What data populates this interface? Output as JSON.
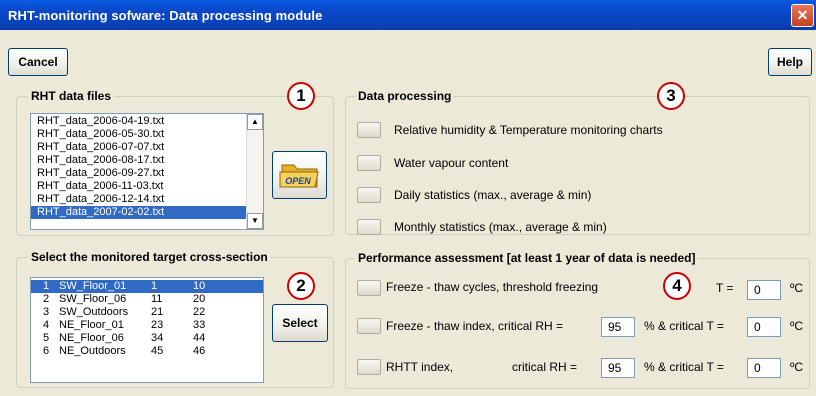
{
  "window": {
    "title": "RHT-monitoring sofware:  Data processing module",
    "close_glyph": "✕"
  },
  "toolbar": {
    "cancel_label": "Cancel",
    "help_label": "Help"
  },
  "files_group": {
    "title": "RHT data files",
    "badge": "1",
    "files": [
      "RHT_data_2006-04-19.txt",
      "RHT_data_2006-05-30.txt",
      "RHT_data_2006-07-07.txt",
      "RHT_data_2006-08-17.txt",
      "RHT_data_2006-09-27.txt",
      "RHT_data_2006-11-03.txt",
      "RHT_data_2006-12-14.txt",
      "RHT_data_2007-02-02.txt"
    ],
    "selected_index": 7,
    "open_label": "OPEN"
  },
  "target_group": {
    "title": "Select the monitored target cross-section",
    "badge": "2",
    "rows": [
      {
        "n": "1",
        "name": "SW_Floor_01",
        "a": "1",
        "b": "10"
      },
      {
        "n": "2",
        "name": "SW_Floor_06",
        "a": "11",
        "b": "20"
      },
      {
        "n": "3",
        "name": "SW_Outdoors",
        "a": "21",
        "b": "22"
      },
      {
        "n": "4",
        "name": "NE_Floor_01",
        "a": "23",
        "b": "33"
      },
      {
        "n": "5",
        "name": "NE_Floor_06",
        "a": "34",
        "b": "44"
      },
      {
        "n": "6",
        "name": "NE_Outdoors",
        "a": "45",
        "b": "46"
      }
    ],
    "selected_index": 0,
    "select_label": "Select"
  },
  "processing_group": {
    "title": "Data processing",
    "badge": "3",
    "items": [
      "Relative humidity & Temperature monitoring charts",
      "Water vapour content",
      "Daily statistics (max., average & min)",
      "Monthly statistics (max., average & min)"
    ]
  },
  "performance_group": {
    "title": "Performance assessment [at least 1 year of data is needed]",
    "badge": "4",
    "freeze_label": "Freeze - thaw cycles, threshold freezing",
    "freeze_t_label": "T =",
    "freeze_t_value": "0",
    "index_label": "Freeze - thaw index, critical RH =",
    "index_rh_value": "95",
    "index_t_label": "% & critical T =",
    "index_t_value": "0",
    "rhtt_label": "RHTT index,",
    "rhtt_rh_label": "critical RH =",
    "rhtt_rh_value": "95",
    "rhtt_t_label": "% & critical T =",
    "rhtt_t_value": "0",
    "unit": "ºC"
  }
}
